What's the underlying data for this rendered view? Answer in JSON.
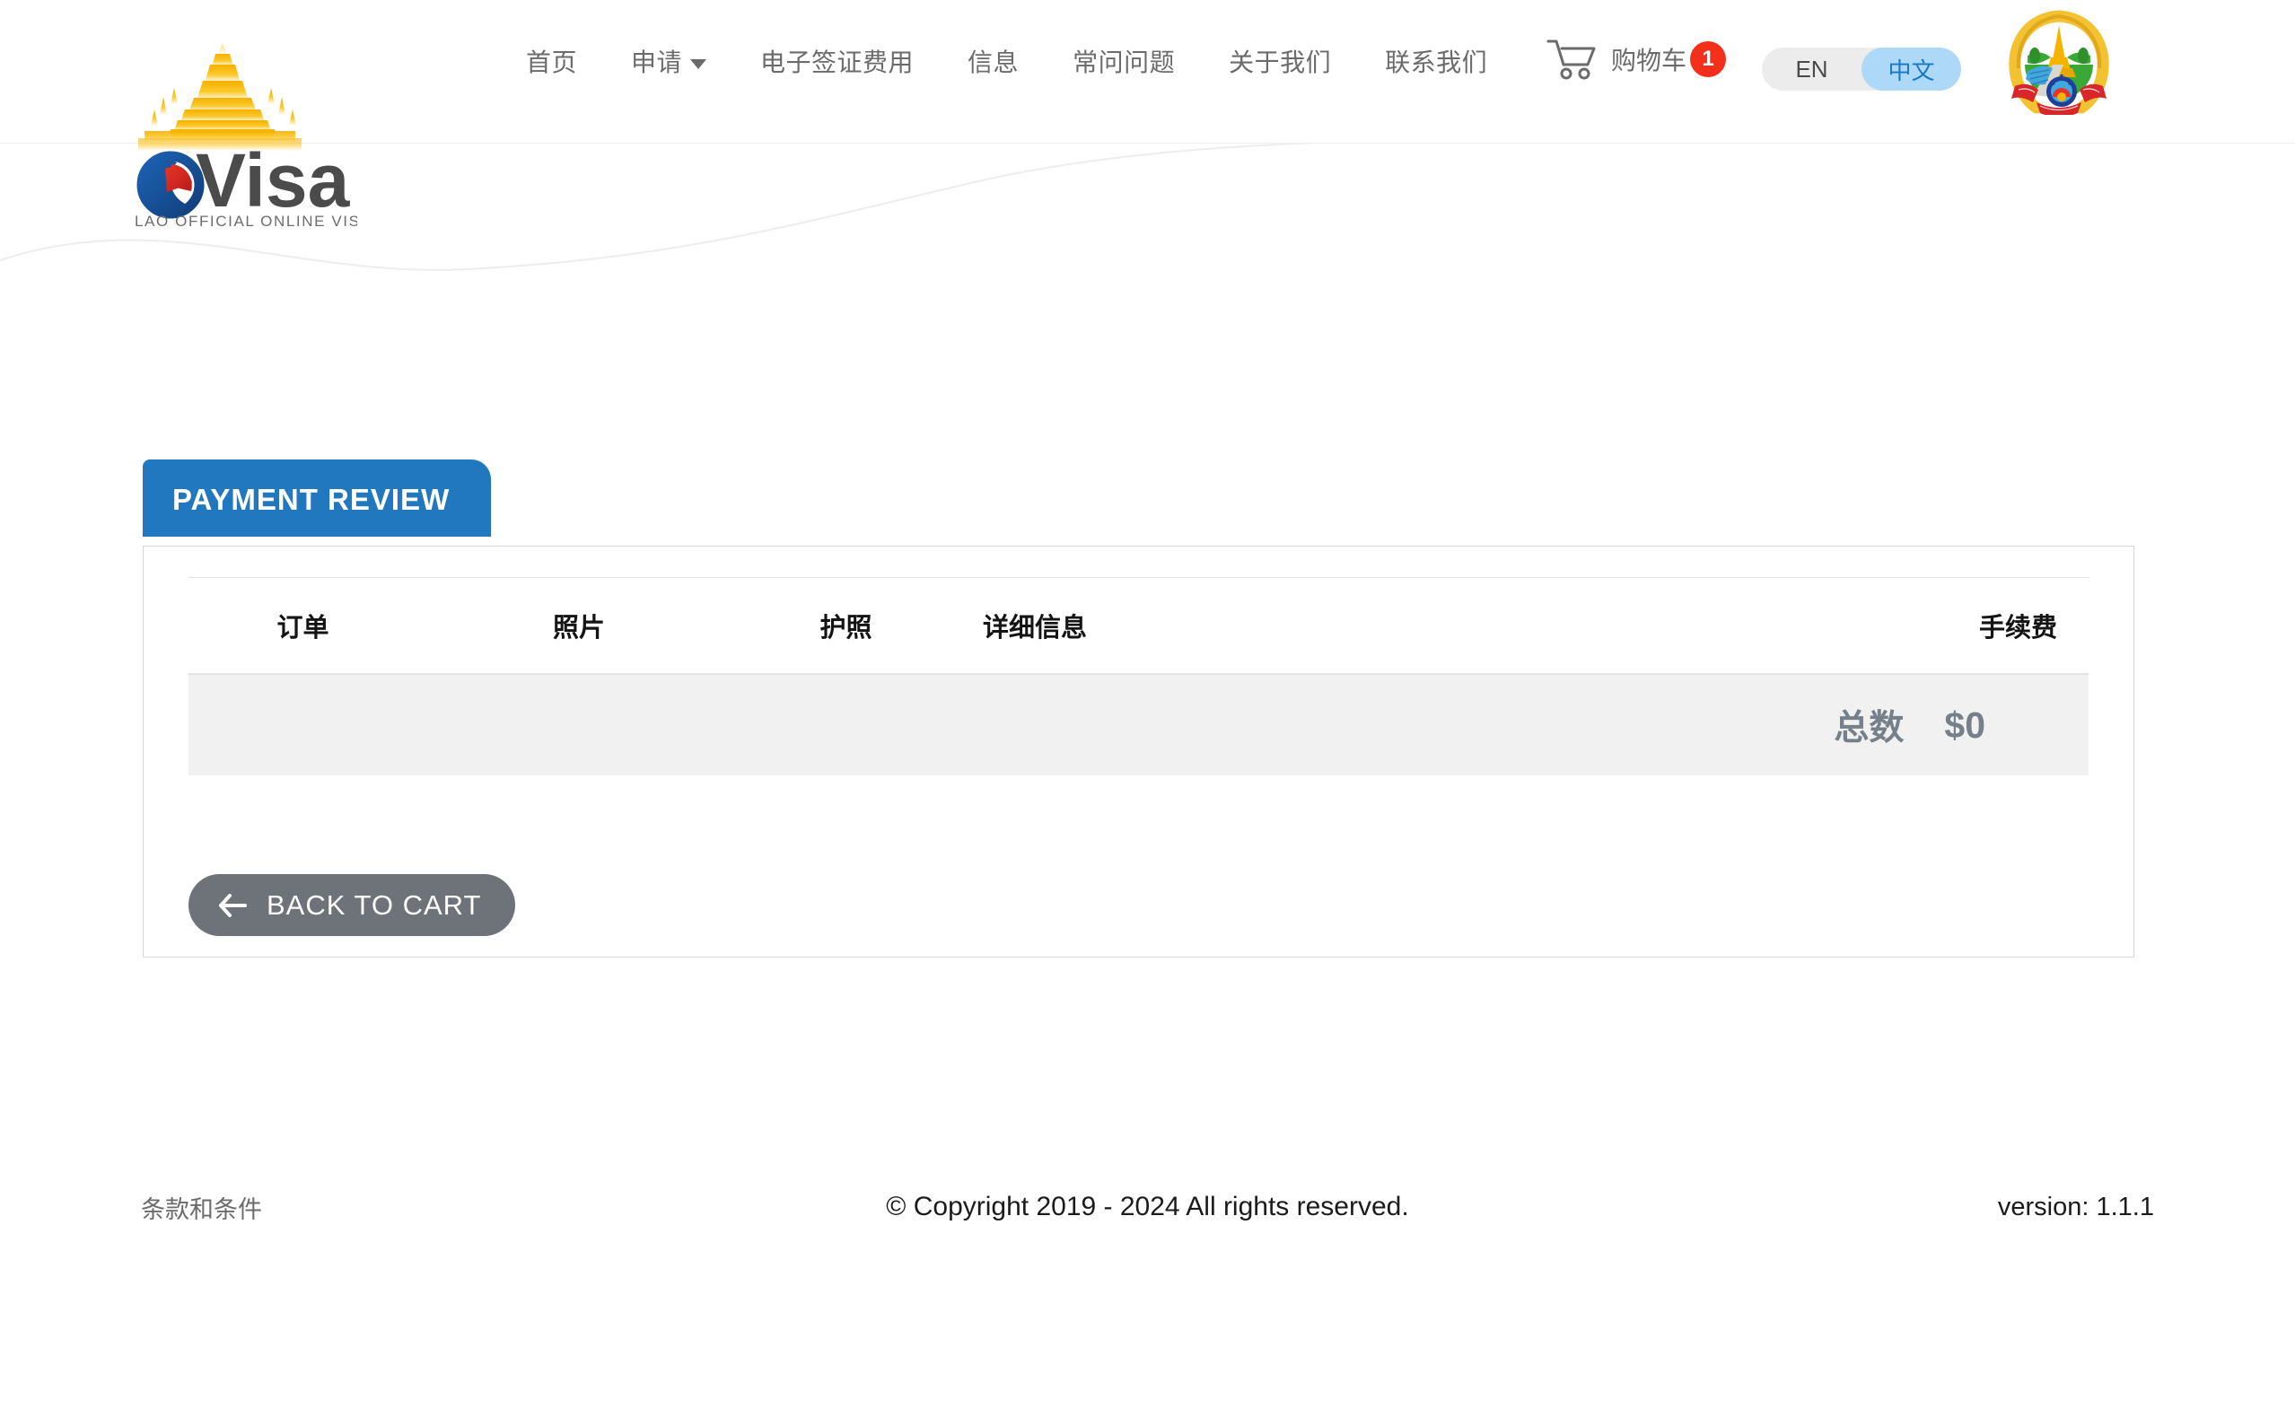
{
  "brand": {
    "logo_text": "eVisa",
    "logo_tagline": "LAO OFFICIAL ONLINE VISA",
    "emblem_name": "lao-national-emblem"
  },
  "nav": {
    "items": [
      {
        "label": "首页",
        "name": "nav-item-home",
        "has_caret": false
      },
      {
        "label": "申请",
        "name": "nav-item-apply",
        "has_caret": true
      },
      {
        "label": "电子签证费用",
        "name": "nav-item-evisa-fees",
        "has_caret": false
      },
      {
        "label": "信息",
        "name": "nav-item-information",
        "has_caret": false
      },
      {
        "label": "常问问题",
        "name": "nav-item-faq",
        "has_caret": false
      },
      {
        "label": "关于我们",
        "name": "nav-item-about-us",
        "has_caret": false
      },
      {
        "label": "联系我们",
        "name": "nav-item-contact-us",
        "has_caret": false
      }
    ]
  },
  "cart": {
    "label": "购物车",
    "count": "1",
    "badge_color": "#f4301a"
  },
  "language": {
    "options": [
      {
        "label": "EN",
        "active": false
      },
      {
        "label": "中文",
        "active": true
      }
    ],
    "active_bg": "#aed8f7",
    "active_text": "#1878c8",
    "inactive_bg": "#ececec"
  },
  "main": {
    "tab_label": "PAYMENT REVIEW",
    "tab_color": "#2178be",
    "table": {
      "headers": [
        "订单",
        "照片",
        "护照",
        "详细信息",
        "手续费"
      ],
      "rows": [],
      "total_label": "总数",
      "total_value": "$0",
      "total_color": "#76808a"
    },
    "back_button": {
      "label": "BACK TO CART",
      "color": "#6d7378"
    }
  },
  "footer": {
    "terms": "条款和条件",
    "copyright": "© Copyright 2019 - 2024 All rights reserved.",
    "version": "version: 1.1.1"
  }
}
